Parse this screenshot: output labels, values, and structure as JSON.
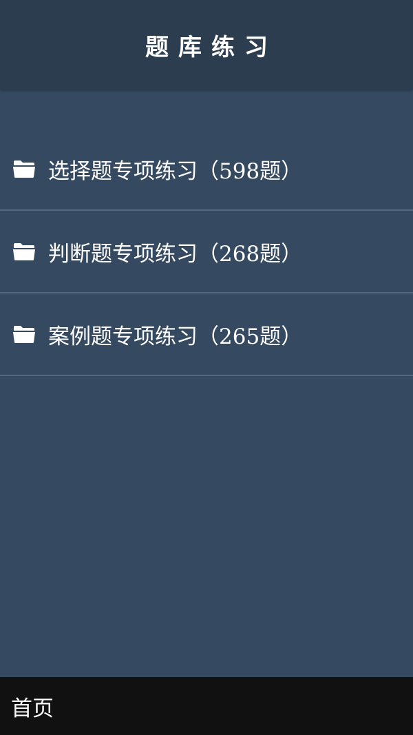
{
  "header": {
    "title": "题库练习"
  },
  "list": {
    "items": [
      {
        "icon": "folder-icon",
        "label": "选择题专项练习（598题）"
      },
      {
        "icon": "folder-icon",
        "label": "判断题专项练习（268题）"
      },
      {
        "icon": "folder-icon",
        "label": "案例题专项练习（265题）"
      }
    ]
  },
  "footer": {
    "home_label": "首页"
  },
  "colors": {
    "background": "#354a60",
    "header": "#2c3d4f",
    "divider": "#55697d",
    "footer": "#111111",
    "text": "#ffffff"
  }
}
